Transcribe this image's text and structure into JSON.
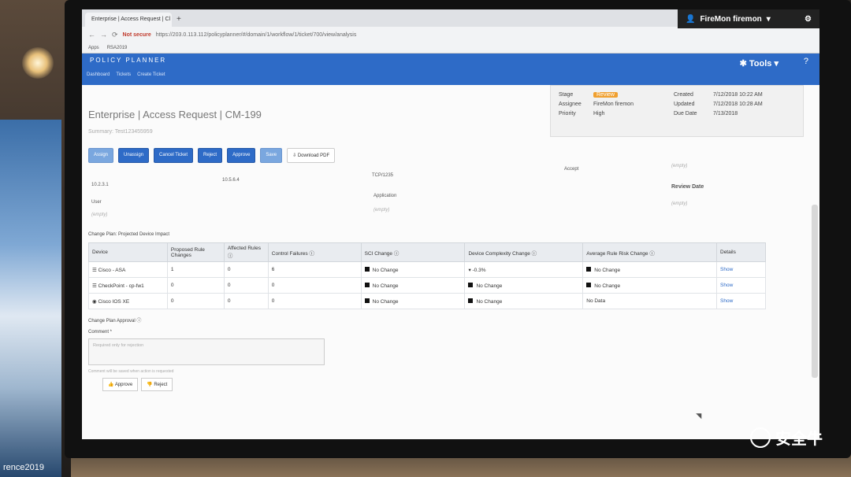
{
  "browser": {
    "tab_title": "Enterprise | Access Request | Cl",
    "tab_close": "×",
    "new_tab": "+",
    "url_warning": "Not secure",
    "url": "https://203.0.113.112/policyplanner/#/domain/1/workflow/1/ticket/700/view/analysis",
    "bookmarks": [
      "Apps",
      "RSA2019"
    ]
  },
  "app": {
    "user_name": "FireMon firemon",
    "tools_label": "Tools",
    "help_label": "?",
    "brand": "POLICY PLANNER",
    "nav": [
      "Dashboard",
      "Tickets",
      "Create Ticket"
    ]
  },
  "ticket": {
    "title": "Enterprise | Access Request | CM-199",
    "summary": "Summary: Test123455959",
    "actions": [
      "Assign",
      "Unassign",
      "Cancel Ticket",
      "Reject",
      "Approve",
      "Save",
      "Download PDF"
    ],
    "meta": {
      "stage_label": "Stage",
      "stage_value": "Review",
      "assignee_label": "Assignee",
      "assignee_value": "FireMon firemon",
      "priority_label": "Priority",
      "priority_value": "High",
      "created_label": "Created",
      "created_value": "7/12/2018 10:22 AM",
      "updated_label": "Updated",
      "updated_value": "7/12/2018 10:28 AM",
      "due_label": "Due Date",
      "due_value": "7/13/2018"
    }
  },
  "rule_info": {
    "src_ip": "10.2.3.1",
    "dst_ip": "10.5.6.4",
    "service": "TCP/1235",
    "action": "Accept",
    "empty": "(empty)",
    "user_label": "User",
    "application_label": "Application",
    "review_date_label": "Review Date"
  },
  "impact": {
    "section_label": "Change Plan: Projected Device Impact",
    "columns": [
      "Device",
      "Proposed Rule Changes",
      "Affected Rules",
      "Control Failures",
      "SCI Change",
      "Device Complexity Change",
      "Average Rule Risk Change",
      "Details"
    ],
    "rows": [
      {
        "device": "Cisco - ASA",
        "proposed": "1",
        "affected": "0",
        "failures": "6",
        "sci": "No Change",
        "complexity": "-0.3%",
        "risk": "No Change",
        "details": "Show"
      },
      {
        "device": "CheckPoint - cp-fw1",
        "proposed": "0",
        "affected": "0",
        "failures": "0",
        "sci": "No Change",
        "complexity": "No Change",
        "risk": "No Change",
        "details": "Show"
      },
      {
        "device": "Cisco IOS XE",
        "proposed": "0",
        "affected": "0",
        "failures": "0",
        "sci": "No Change",
        "complexity": "No Change",
        "risk": "No Data",
        "details": "Show"
      }
    ]
  },
  "approval": {
    "label": "Change Plan Approval",
    "comment_label": "Comment *",
    "comment_placeholder": "Required only for rejection",
    "comment_hint": "Comment will be saved when action is requested",
    "approve": "Approve",
    "reject": "Reject"
  },
  "environment": {
    "poster_text": "rence2019",
    "watermark": "安全牛"
  }
}
